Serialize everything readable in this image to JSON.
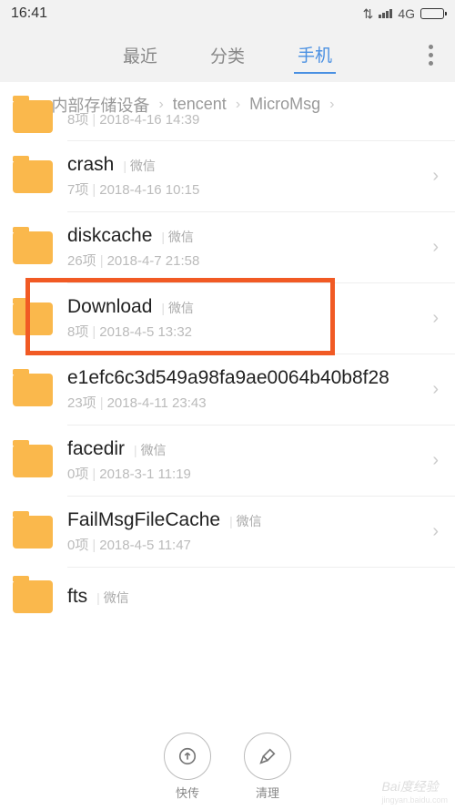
{
  "status": {
    "time": "16:41",
    "network": "4G"
  },
  "tabs": {
    "items": [
      "最近",
      "分类",
      "手机"
    ],
    "active_index": 2
  },
  "breadcrumb": {
    "items": [
      "内部存储设备",
      "tencent",
      "MicroMsg"
    ]
  },
  "files": [
    {
      "name": "",
      "tag": "",
      "count": "8项",
      "date": "2018-4-16 14:39",
      "partial": "top"
    },
    {
      "name": "crash",
      "tag": "微信",
      "count": "7项",
      "date": "2018-4-16 10:15"
    },
    {
      "name": "diskcache",
      "tag": "微信",
      "count": "26项",
      "date": "2018-4-7 21:58"
    },
    {
      "name": "Download",
      "tag": "微信",
      "count": "8项",
      "date": "2018-4-5 13:32",
      "highlight": true
    },
    {
      "name": "e1efc6c3d549a98fa9ae0064b40b8f28",
      "tag": "",
      "count": "23项",
      "date": "2018-4-11 23:43"
    },
    {
      "name": "facedir",
      "tag": "微信",
      "count": "0项",
      "date": "2018-3-1 11:19"
    },
    {
      "name": "FailMsgFileCache",
      "tag": "微信",
      "count": "0项",
      "date": "2018-4-5 11:47"
    },
    {
      "name": "fts",
      "tag": "微信",
      "count": "",
      "date": "",
      "partial": "bottom"
    }
  ],
  "fab": {
    "transfer": "快传",
    "clean": "清理"
  },
  "watermark": {
    "brand": "Bai度经验",
    "url": "jingyan.baidu.com"
  }
}
